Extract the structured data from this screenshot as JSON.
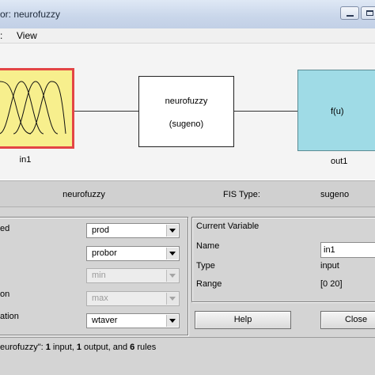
{
  "window": {
    "title": "or: neurofuzzy"
  },
  "menu": {
    "items": [
      ":",
      "View"
    ]
  },
  "diagram": {
    "input": {
      "label": "in1"
    },
    "system": {
      "name": "neurofuzzy",
      "type": "(sugeno)"
    },
    "output": {
      "function": "f(u)",
      "label": "out1"
    }
  },
  "info": {
    "fis_name": "neurofuzzy",
    "fis_type_label": "FIS Type:",
    "fis_type_value": "sugeno"
  },
  "methods": {
    "rows": [
      {
        "label": "ed",
        "value": "prod",
        "enabled": true
      },
      {
        "label": "",
        "value": "probor",
        "enabled": true
      },
      {
        "label": "",
        "value": "min",
        "enabled": false
      },
      {
        "label": "on",
        "value": "max",
        "enabled": false
      },
      {
        "label": "ation",
        "value": "wtaver",
        "enabled": true
      }
    ]
  },
  "current_variable": {
    "heading": "Current Variable",
    "name_label": "Name",
    "name_value": "in1",
    "type_label": "Type",
    "type_value": "input",
    "range_label": "Range",
    "range_value": "[0 20]"
  },
  "buttons": {
    "help": "Help",
    "close": "Close"
  },
  "status": {
    "prefix": "eurofuzzy\": ",
    "bold": "1",
    "text": " input, ",
    "bold2": "1",
    "text2": " output, and ",
    "bold3": "6",
    "text3": " rules"
  },
  "colors": {
    "input_box": "#f7ef8d",
    "input_border": "#e34545",
    "output_box": "#9fdbe6"
  }
}
